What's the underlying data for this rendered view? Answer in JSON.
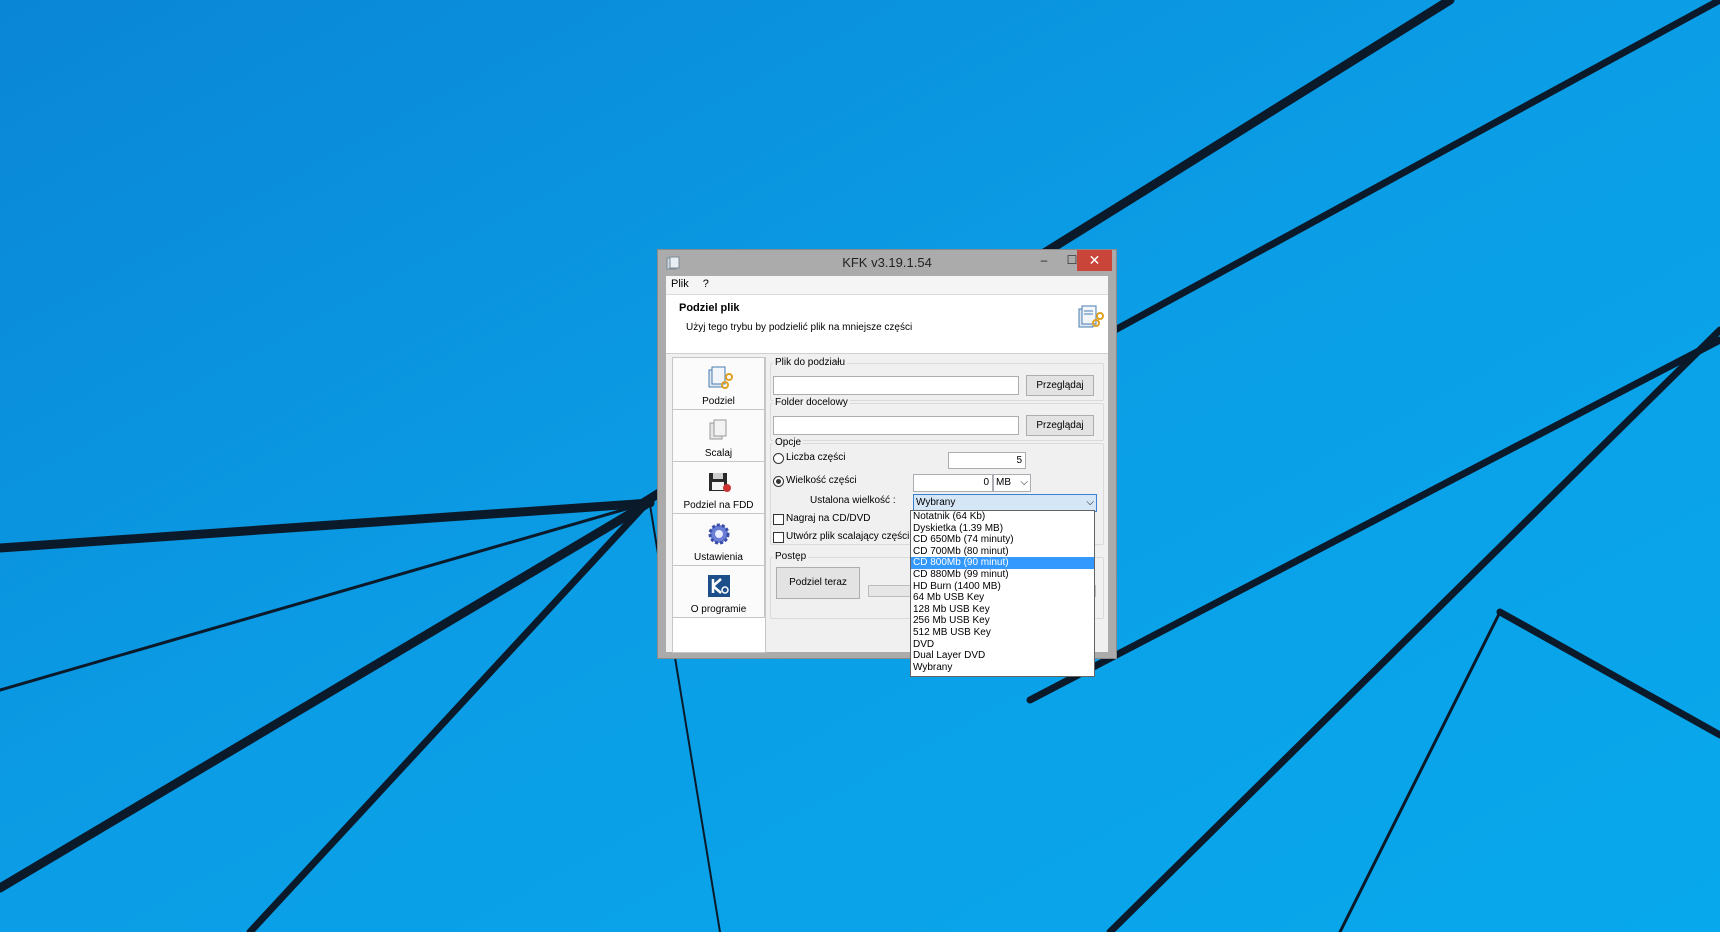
{
  "desktop": {
    "wallpaper_color": "#0aa0e6"
  },
  "window": {
    "title": "KFK v3.19.1.54",
    "minimize_glyph": "–",
    "maximize_glyph": "☐",
    "close_glyph": "✕"
  },
  "menu": {
    "items": [
      "Plik",
      "?"
    ]
  },
  "header": {
    "title": "Podziel plik",
    "description": "Użyj tego trybu by podzielić plik na mniejsze części"
  },
  "nav": [
    {
      "label": "Podziel",
      "icon": "split-icon"
    },
    {
      "label": "Scalaj",
      "icon": "merge-icon"
    },
    {
      "label": "Podziel na FDD",
      "icon": "floppy-icon"
    },
    {
      "label": "Ustawienia",
      "icon": "gear-icon"
    },
    {
      "label": "O programie",
      "icon": "about-icon"
    }
  ],
  "split": {
    "file_group_label": "Plik do podziału",
    "file_value": "",
    "browse_label": "Przeglądaj",
    "folder_group_label": "Folder docelowy",
    "folder_value": "",
    "options_group_label": "Opcje",
    "parts_count_label": "Liczba części",
    "parts_count_value": "5",
    "part_size_label": "Wielkość części",
    "part_size_value": "0",
    "part_size_unit": "MB",
    "preset_label": "Ustalona wielkość :",
    "preset_value": "Wybrany",
    "burn_label": "Nagraj na CD/DVD",
    "create_merger_label": "Utwórz plik scalający części",
    "progress_group_label": "Postęp",
    "split_now_label": "Podziel teraz"
  },
  "dropdown": {
    "items": [
      "Notatnik (64 Kb)",
      "Dyskietka (1.39 MB)",
      "CD 650Mb (74 minuty)",
      "CD 700Mb (80 minut)",
      "CD 800Mb (90 minut)",
      "CD 880Mb (99 minut)",
      "HD Burn (1400 MB)",
      "64 Mb USB Key",
      "128 Mb USB Key",
      "256 Mb USB Key",
      "512 MB USB Key",
      "DVD",
      "Dual Layer DVD",
      "Wybrany"
    ],
    "selected_index": 4
  }
}
